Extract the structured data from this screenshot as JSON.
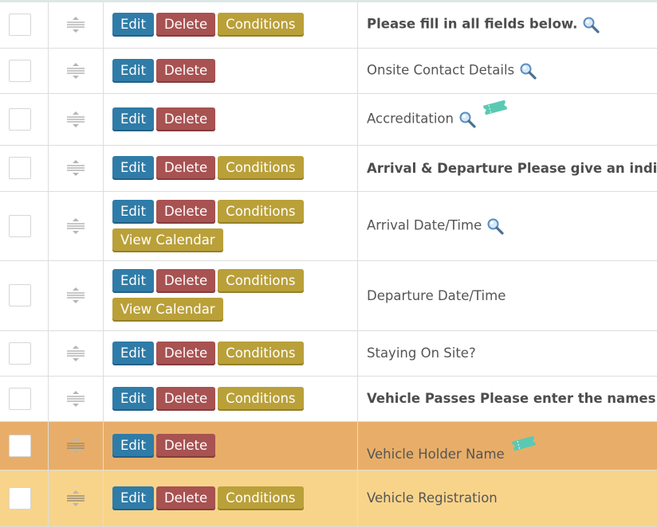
{
  "buttons": {
    "edit": "Edit",
    "delete": "Delete",
    "conditions": "Conditions",
    "view_calendar": "View Calendar"
  },
  "colors": {
    "edit": "#2f7ca8",
    "delete": "#a85252",
    "conditions": "#baa039",
    "row_highlight_1": "#e8ae69",
    "row_highlight_2": "#f8d48a",
    "ticket_icon": "#5ac9b3"
  },
  "rows": [
    {
      "label": "Please fill in all fields below.",
      "bold": true,
      "icons": [
        "magnifier-icon"
      ]
    },
    {
      "label": "Onsite Contact Details",
      "bold": false,
      "icons": [
        "magnifier-icon"
      ]
    },
    {
      "label": "Accreditation",
      "bold": false,
      "icons": [
        "magnifier-icon",
        "ticket-icon"
      ]
    },
    {
      "label": "Arrival & Departure Please give an indication of",
      "bold": true,
      "icons": []
    },
    {
      "label": "Arrival Date/Time",
      "bold": false,
      "icons": [
        "magnifier-icon"
      ]
    },
    {
      "label": "Departure Date/Time",
      "bold": false,
      "icons": []
    },
    {
      "label": "Staying On Site?",
      "bold": false,
      "icons": []
    },
    {
      "label": "Vehicle Passes Please enter the names of your",
      "bold": true,
      "icons": []
    },
    {
      "label": "Vehicle Holder Name",
      "bold": false,
      "icons": [
        "ticket-icon"
      ]
    },
    {
      "label": "Vehicle Registration",
      "bold": false,
      "icons": []
    }
  ]
}
